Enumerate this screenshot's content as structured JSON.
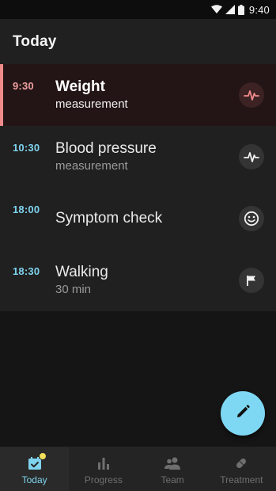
{
  "status_bar": {
    "time": "9:40"
  },
  "app_bar": {
    "title": "Today"
  },
  "tasks": [
    {
      "time": "9:30",
      "title": "Weight",
      "subtitle": "measurement",
      "icon": "pulse-icon",
      "active": true
    },
    {
      "time": "10:30",
      "title": "Blood pressure",
      "subtitle": "measurement",
      "icon": "pulse-icon",
      "active": false
    },
    {
      "time": "18:00",
      "title": "Symptom check",
      "subtitle": "",
      "icon": "smiley-icon",
      "active": false
    },
    {
      "time": "18:30",
      "title": "Walking",
      "subtitle": "30 min",
      "icon": "flag-icon",
      "active": false
    }
  ],
  "fab": {
    "icon": "pencil-icon"
  },
  "bottom_nav": {
    "items": [
      {
        "label": "Today",
        "icon": "calendar-check-icon",
        "active": true,
        "badge": true
      },
      {
        "label": "Progress",
        "icon": "bar-chart-icon",
        "active": false
      },
      {
        "label": "Team",
        "icon": "people-icon",
        "active": false
      },
      {
        "label": "Treatment",
        "icon": "pill-icon",
        "active": false
      }
    ]
  },
  "colors": {
    "accent": "#7fd3ee",
    "active_time": "#f0a0a0",
    "active_marker": "#f08b8b",
    "badge": "#f3e05a"
  }
}
